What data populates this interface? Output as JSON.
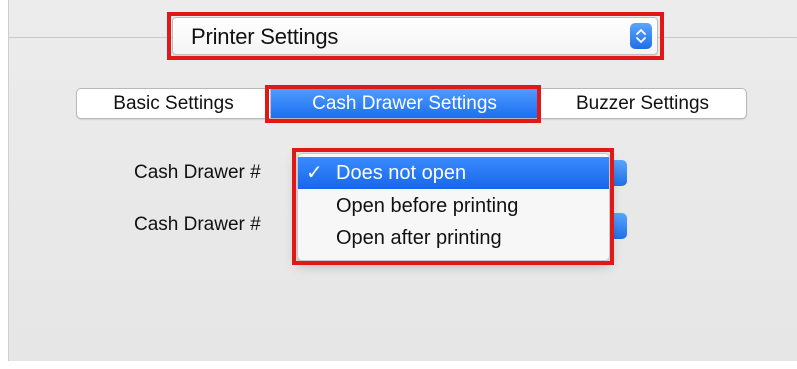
{
  "printer_select": {
    "value": "Printer Settings",
    "icon": "stepper-icon"
  },
  "tabs": [
    {
      "label": "Basic Settings",
      "active": false
    },
    {
      "label": "Cash Drawer Settings",
      "active": true
    },
    {
      "label": "Buzzer Settings",
      "active": false
    }
  ],
  "fields": [
    {
      "label": "Cash Drawer #"
    },
    {
      "label": "Cash Drawer #"
    }
  ],
  "dropdown": {
    "options": [
      {
        "label": "Does not open",
        "checkmark": "✓",
        "selected": true
      },
      {
        "label": "Open before printing",
        "selected": false
      },
      {
        "label": "Open after printing",
        "selected": false
      }
    ]
  },
  "colors": {
    "accent": "#1f6fe6",
    "highlight_box": "#e01818"
  }
}
